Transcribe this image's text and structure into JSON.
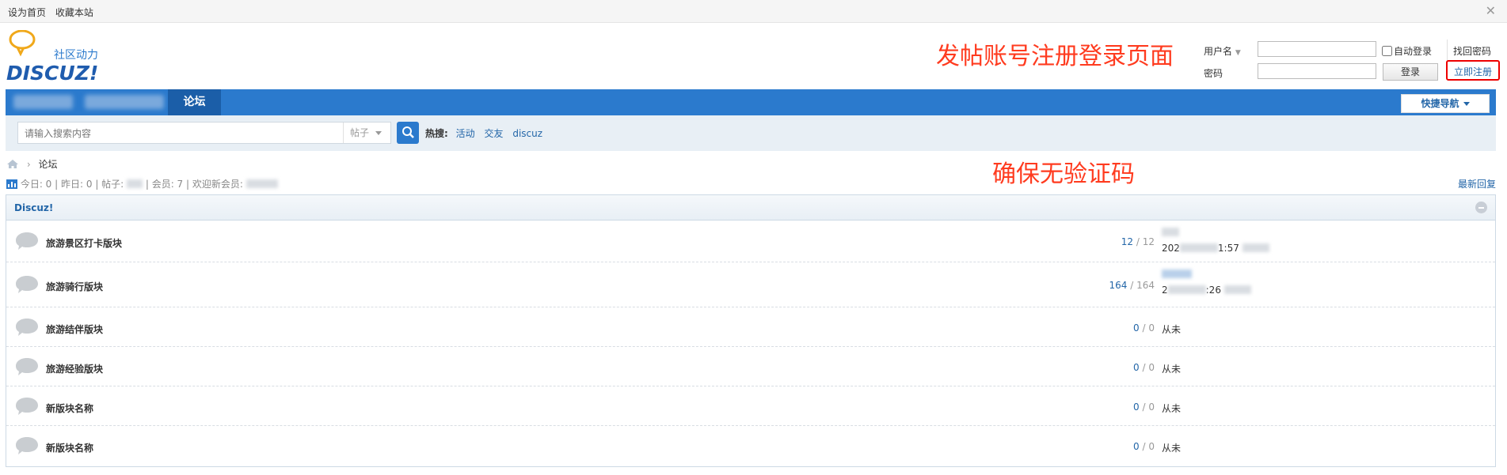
{
  "toolbar": {
    "set_home": "设为首页",
    "bookmark": "收藏本站",
    "close": "✕"
  },
  "logo": {
    "tagline": "社区动力",
    "brand": "DISCUZ!"
  },
  "annotations": {
    "top": "发帖账号注册登录页面",
    "middle": "确保无验证码"
  },
  "login": {
    "username_label": "用户名",
    "password_label": "密码",
    "auto_login": "自动登录",
    "login_button": "登录",
    "forgot_password": "找回密码",
    "register": "立即注册"
  },
  "nav": {
    "active_item": "论坛",
    "quick_nav": "快捷导航"
  },
  "search": {
    "placeholder": "请输入搜索内容",
    "type": "帖子",
    "hot_label": "热搜:",
    "hot_items": [
      "活动",
      "交友",
      "discuz"
    ]
  },
  "breadcrumb": {
    "current": "论坛"
  },
  "stats": {
    "today": "今日: 0",
    "yesterday": "昨日: 0",
    "posts": "帖子: ",
    "members": "会员: 7",
    "welcome": "欢迎新会员: "
  },
  "latest_reply": "最新回复",
  "category": {
    "name": "Discuz!"
  },
  "forums": [
    {
      "name": "旅游景区打卡版块",
      "threads": "12",
      "posts": "12",
      "last": "202 1:57",
      "last_prefix": "202",
      "last_suffix": "1:57"
    },
    {
      "name": "旅游骑行版块",
      "threads": "164",
      "posts": "164",
      "last": "6 :26",
      "last_prefix": "2",
      "last_suffix": ":26"
    },
    {
      "name": "旅游结伴版块",
      "threads": "0",
      "posts": "0",
      "last": "从未"
    },
    {
      "name": "旅游经验版块",
      "threads": "0",
      "posts": "0",
      "last": "从未"
    },
    {
      "name": "新版块名称",
      "threads": "0",
      "posts": "0",
      "last": "从未"
    },
    {
      "name": "新版块名称",
      "threads": "0",
      "posts": "0",
      "last": "从未"
    }
  ],
  "colors": {
    "nav_blue": "#2b7acd",
    "nav_active": "#1b5ea8",
    "link_blue": "#2366a8",
    "annotation_red": "#ff3b1f",
    "highlight_border": "#e00000"
  }
}
